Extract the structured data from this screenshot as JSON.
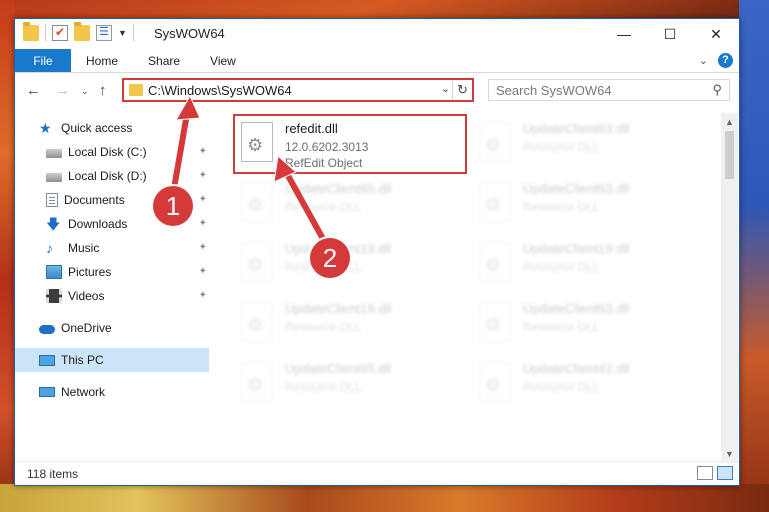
{
  "window": {
    "title": "SysWOW64",
    "minimize": "—",
    "maximize": "☐",
    "close": "✕"
  },
  "ribbon": {
    "tabs": [
      "File",
      "Home",
      "Share",
      "View"
    ]
  },
  "address": {
    "path": "C:\\Windows\\SysWOW64"
  },
  "search": {
    "placeholder": "Search SysWOW64"
  },
  "sidebar": {
    "items": [
      {
        "label": "Quick access",
        "icon": "star-icon",
        "pinned": false
      },
      {
        "label": "Local Disk (C:)",
        "icon": "drive-icon",
        "pinned": true
      },
      {
        "label": "Local Disk (D:)",
        "icon": "drive-icon",
        "pinned": true
      },
      {
        "label": "Documents",
        "icon": "documents-icon",
        "pinned": true
      },
      {
        "label": "Downloads",
        "icon": "download-icon",
        "pinned": true
      },
      {
        "label": "Music",
        "icon": "music-icon",
        "pinned": true
      },
      {
        "label": "Pictures",
        "icon": "pictures-icon",
        "pinned": true
      },
      {
        "label": "Videos",
        "icon": "videos-icon",
        "pinned": true
      },
      {
        "label": "OneDrive",
        "icon": "cloud-icon",
        "pinned": false
      },
      {
        "label": "This PC",
        "icon": "computer-icon",
        "pinned": false,
        "selected": true
      },
      {
        "label": "Network",
        "icon": "network-icon",
        "pinned": false
      }
    ]
  },
  "files": [
    {
      "name": "refedit.dll",
      "version": "12.0.6202.3013",
      "description": "RefEdit Object",
      "highlighted": true
    },
    {
      "name": "UpdateClient63.dll",
      "description": "Resource DLL"
    },
    {
      "name": "UpdateClient65.dll",
      "description": "Resource DLL"
    },
    {
      "name": "UpdateClient63.dll",
      "description": "Resource DLL"
    },
    {
      "name": "UpdateClient19.dll",
      "description": "Resource DLL"
    },
    {
      "name": "UpdateClient19.dll",
      "description": "Resource DLL"
    },
    {
      "name": "UpdateClient19.dll",
      "description": "Resource DLL"
    },
    {
      "name": "UpdateClient63.dll",
      "description": "Resource DLL"
    },
    {
      "name": "UpdateClient65.dll",
      "description": "Resource DLL"
    },
    {
      "name": "UpdateClient42.dll",
      "description": "Resource DLL"
    }
  ],
  "status": {
    "item_count": "118 items"
  },
  "annotations": {
    "step1": "1",
    "step2": "2",
    "color": "#d43a3a"
  }
}
